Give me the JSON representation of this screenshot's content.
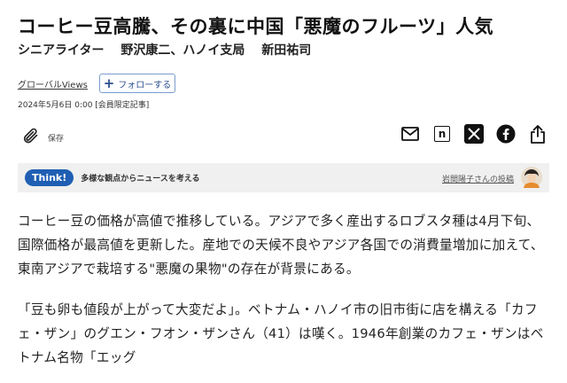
{
  "article": {
    "headline": "コーヒー豆高騰、その裏に中国「悪魔のフルーツ」人気",
    "byline": {
      "role": "シニアライター",
      "author1": "野沢康二、ハノイ支局",
      "author2": "新田祐司"
    },
    "topic_link": "グローバルViews",
    "follow_button": "フォローする",
    "date": "2024年5月6日 0:00 [会員限定記事]",
    "save_label": "保存",
    "share_icons": [
      "mail-icon",
      "note-icon",
      "x-icon",
      "facebook-icon",
      "share-icon"
    ],
    "note_glyph": "n",
    "think": {
      "badge": "Think!",
      "text": "多様な観点からニュースを考える",
      "link": "岩間陽子さんの投稿"
    },
    "body": {
      "para1": "コーヒー豆の価格が高値で推移している。アジアで多く産出するロブスタ種は4月下旬、国際価格が最高値を更新した。産地での天候不良やアジア各国での消費量増加に加えて、東南アジアで栽培する\"悪魔の果物\"の存在が背景にある。",
      "para2": "「豆も卵も値段が上がって大変だよ」。ベトナム・ハノイ市の旧市街に店を構える「カフェ・ザン」のグエン・フオン・ザンさん（41）は嘆く。1946年創業のカフェ・ザンはベトナム名物「エッグ"
    }
  },
  "colors": {
    "accent": "#1f5fb3",
    "follow_border": "#7a9ccf",
    "think_bg": "#f0f0f0"
  }
}
